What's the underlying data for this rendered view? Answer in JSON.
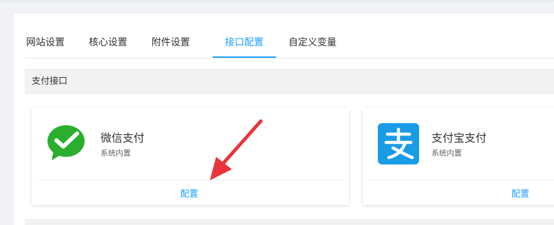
{
  "tabs": [
    {
      "label": "网站设置",
      "active": false
    },
    {
      "label": "核心设置",
      "active": false
    },
    {
      "label": "附件设置",
      "active": false
    },
    {
      "label": "接口配置",
      "active": true
    },
    {
      "label": "自定义变量",
      "active": false
    }
  ],
  "section": {
    "title": "支付接口"
  },
  "cards": [
    {
      "title": "微信支付",
      "subtitle": "系统内置",
      "action": "配置",
      "icon": "wechat-pay-icon"
    },
    {
      "title": "支付宝支付",
      "subtitle": "系统内置",
      "action": "配置",
      "icon": "alipay-icon"
    }
  ],
  "colors": {
    "accent": "#1e9fff",
    "wechat_green": "#2aae2e",
    "alipay_blue": "#1a9be6",
    "annotation_red": "#e8343a"
  }
}
